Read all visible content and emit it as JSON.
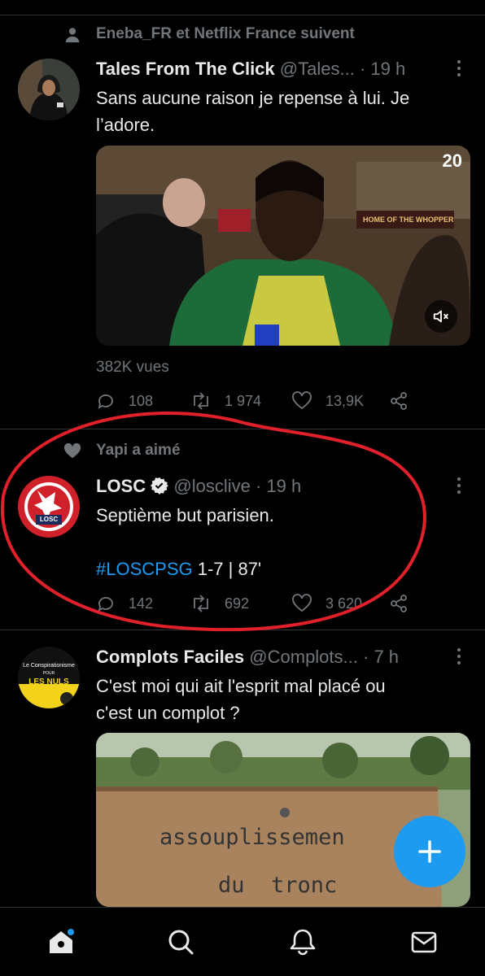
{
  "feed": {
    "tweets": [
      {
        "social_context": "Eneba_FR et Netflix France suivent",
        "name": "Tales From The Click",
        "handle": "@Tales...",
        "time": "· 19 h",
        "text_line1": "Sans aucune raison je repense à lui. Je",
        "text_line2": "l’adore.",
        "media_watermark": "20",
        "media_sign": "HOME OF THE WHOPPER",
        "views": "382K vues",
        "replies": "108",
        "retweets": "1 974",
        "likes": "13,9K"
      },
      {
        "social_context": "Yapi a aimé",
        "name": "LOSC",
        "handle": "@losclive",
        "time": "· 19 h",
        "text_line1": "Septième but parisien.",
        "hashtag": "#LOSCPSG",
        "text_after_hashtag": " 1-7 | 87'",
        "avatar_text": "LOSC",
        "replies": "142",
        "retweets": "692",
        "likes": "3 620"
      },
      {
        "name": "Complots Faciles",
        "handle": "@Complots...",
        "time": "· 7 h",
        "text_line1": "C'est moi qui ait l'esprit mal placé ou",
        "text_line2": "c'est un complot ?",
        "avatar_line1": "Le Conspirationisme",
        "avatar_line2": "POUR",
        "avatar_line3": "LES NULS",
        "media_sign_line1": "assouplissemen",
        "media_sign_line2": "du  tronc"
      }
    ]
  },
  "colors": {
    "accent": "#1d9bf0",
    "muted": "#71767b",
    "annotation": "#e0202a"
  }
}
